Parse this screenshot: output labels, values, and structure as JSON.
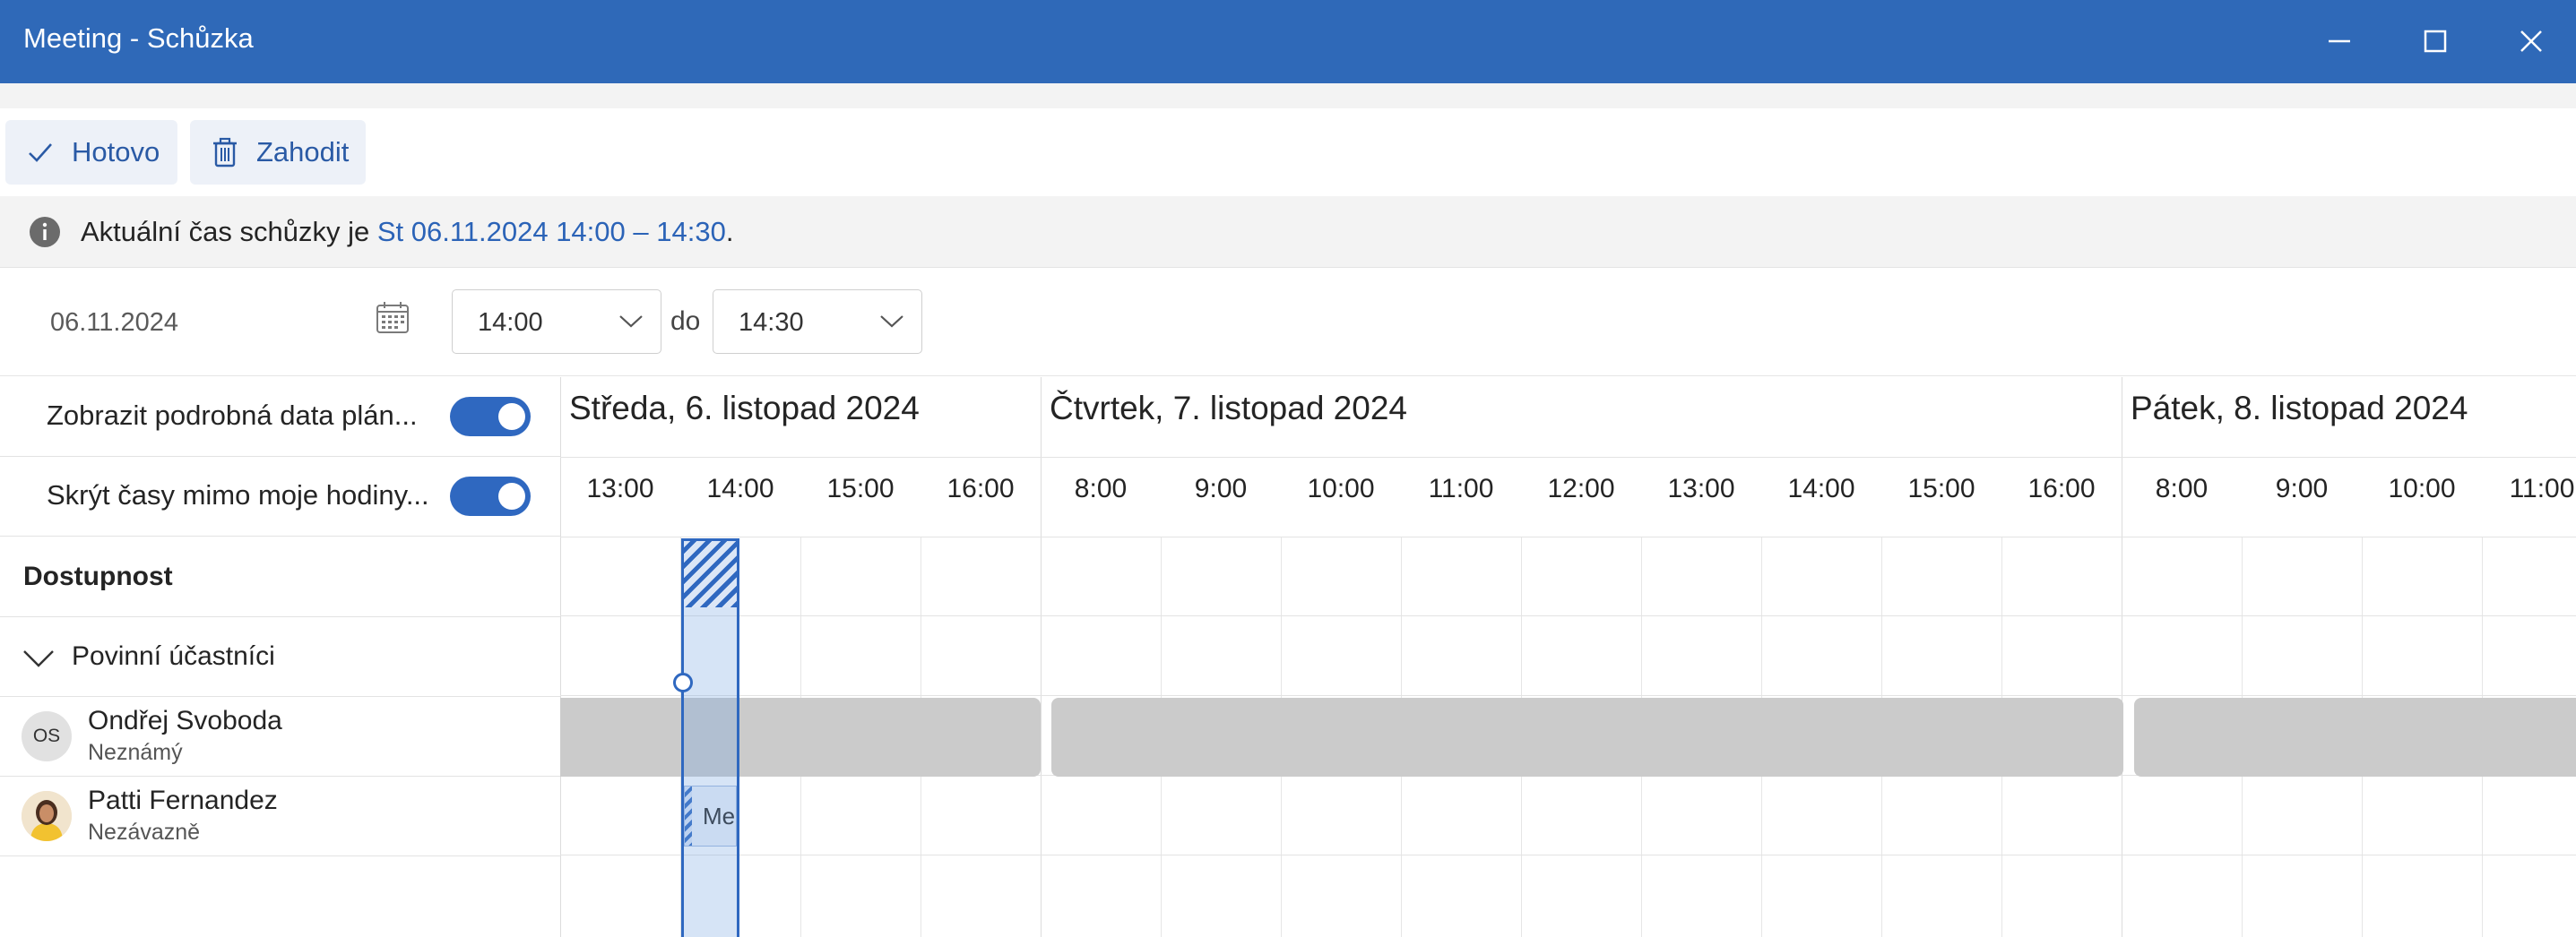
{
  "window": {
    "title": "Meeting - Schůzka"
  },
  "toolbar": {
    "done_label": "Hotovo",
    "discard_label": "Zahodit"
  },
  "info": {
    "prefix": "Aktuální čas schůzky je ",
    "link": "St 06.11.2024 14:00 – 14:30",
    "suffix": "."
  },
  "schedule": {
    "date": "06.11.2024",
    "start_time": "14:00",
    "to_label": "do",
    "end_time": "14:30"
  },
  "options": {
    "show_details_label": "Zobrazit podrobná data plán...",
    "show_details_on": true,
    "hide_offhours_label": "Skrýt časy mimo moje hodiny...",
    "hide_offhours_on": true
  },
  "sections": {
    "availability": "Dostupnost",
    "required": "Povinní účastníci"
  },
  "attendees": [
    {
      "initials": "OS",
      "name": "Ondřej Svoboda",
      "status": "Neznámý"
    },
    {
      "initials": "",
      "name": "Patti Fernandez",
      "status": "Nezávazně"
    }
  ],
  "days": [
    {
      "label": "Středa, 6. listopad 2024",
      "hours": [
        "13:00",
        "14:00",
        "15:00",
        "16:00"
      ]
    },
    {
      "label": "Čtvrtek, 7. listopad 2024",
      "hours": [
        "8:00",
        "9:00",
        "10:00",
        "11:00",
        "12:00",
        "13:00",
        "14:00",
        "15:00",
        "16:00"
      ]
    },
    {
      "label": "Pátek, 8. listopad 2024",
      "hours": [
        "8:00",
        "9:00",
        "10:00",
        "11:00"
      ]
    }
  ],
  "meeting_block": {
    "label": "Meeting"
  },
  "colors": {
    "accent": "#2f68c0",
    "titlebar": "#2f69b8",
    "busy": "#cbcbcb"
  }
}
